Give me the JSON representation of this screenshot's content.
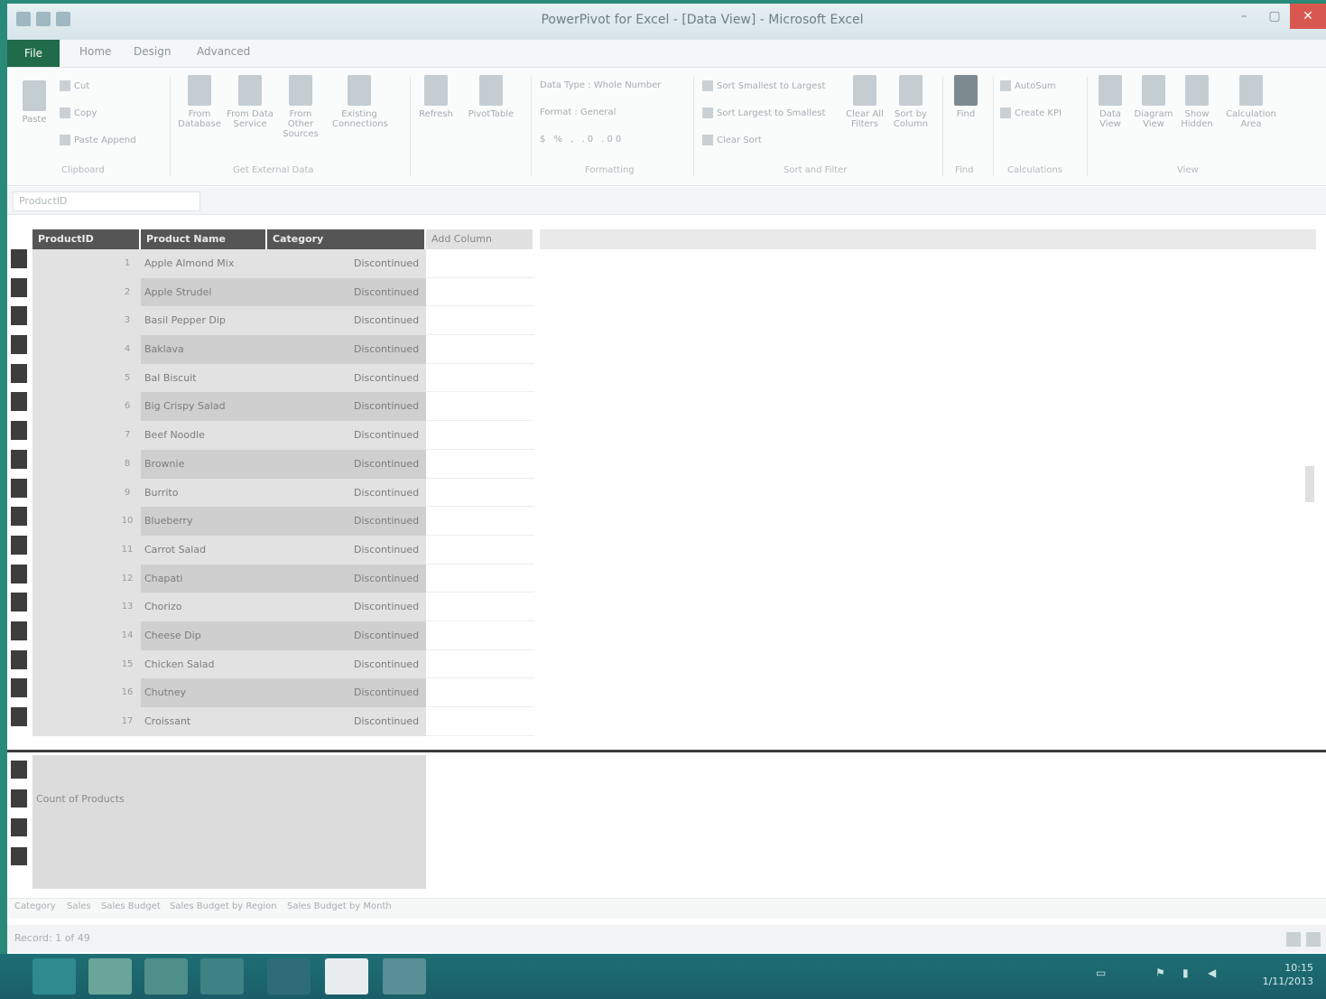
{
  "window": {
    "title": "PowerPivot for Excel - [Data View] - Microsoft Excel",
    "minimize_glyph": "–",
    "maximize_glyph": "▢",
    "close_glyph": "✕"
  },
  "tabs": [
    "File",
    "Home",
    "Design",
    "Advanced"
  ],
  "ribbon": {
    "clipboard": {
      "paste": "Paste",
      "items": [
        "Cut",
        "Copy",
        "Paste Append"
      ],
      "group": "Clipboard"
    },
    "get_data": {
      "buttons": [
        "From Database",
        "From Data Service",
        "From Other Sources",
        "Existing Connections"
      ],
      "group": "Get External Data"
    },
    "refresh": "Refresh",
    "pivottable": "PivotTable",
    "formatting": {
      "items": [
        "Data Type : Whole Number",
        "Format : General",
        "$ % , .0 .00"
      ],
      "group": "Formatting"
    },
    "sort_filter": {
      "items": [
        "Sort Smallest to Largest",
        "Sort Largest to Smallest",
        "Clear Sort"
      ],
      "buttons": [
        "Clear All Filters",
        "Sort by Column"
      ],
      "group": "Sort and Filter"
    },
    "find": {
      "button": "Find",
      "group": "Find"
    },
    "calculations": {
      "items": [
        "AutoSum",
        "Create KPI"
      ],
      "group": "Calculations"
    },
    "view": {
      "buttons": [
        "Data View",
        "Diagram View",
        "Show Hidden",
        "Calculation Area"
      ],
      "group": "View"
    }
  },
  "formula_bar": {
    "name_box": "ProductID",
    "value": ""
  },
  "columns": [
    "ProductID",
    "Product Name",
    "Category",
    "Add Column"
  ],
  "rows": [
    {
      "num": "1",
      "name": "Apple Almond Mix",
      "value": "Discontinued"
    },
    {
      "num": "2",
      "name": "Apple Strudel",
      "value": "Discontinued"
    },
    {
      "num": "3",
      "name": "Basil Pepper Dip",
      "value": "Discontinued"
    },
    {
      "num": "4",
      "name": "Baklava",
      "value": "Discontinued"
    },
    {
      "num": "5",
      "name": "Bal Biscuit",
      "value": "Discontinued"
    },
    {
      "num": "6",
      "name": "Big Crispy Salad",
      "value": "Discontinued"
    },
    {
      "num": "7",
      "name": "Beef Noodle",
      "value": "Discontinued"
    },
    {
      "num": "8",
      "name": "Brownie",
      "value": "Discontinued"
    },
    {
      "num": "9",
      "name": "Burrito",
      "value": "Discontinued"
    },
    {
      "num": "10",
      "name": "Blueberry",
      "value": "Discontinued"
    },
    {
      "num": "11",
      "name": "Carrot Salad",
      "value": "Discontinued"
    },
    {
      "num": "12",
      "name": "Chapati",
      "value": "Discontinued"
    },
    {
      "num": "13",
      "name": "Chorizo",
      "value": "Discontinued"
    },
    {
      "num": "14",
      "name": "Cheese Dip",
      "value": "Discontinued"
    },
    {
      "num": "15",
      "name": "Chicken Salad",
      "value": "Discontinued"
    },
    {
      "num": "16",
      "name": "Chutney",
      "value": "Discontinued"
    },
    {
      "num": "17",
      "name": "Croissant",
      "value": "Discontinued"
    }
  ],
  "calc_area": {
    "label": "Count of Products"
  },
  "sheet_tabs": [
    "Category",
    "Sales",
    "Sales Budget",
    "Sales Budget by Region",
    "Sales Budget by Month"
  ],
  "status": {
    "record": "Record: 1 of 49"
  },
  "taskbar": {
    "apps": [
      "internet-explorer",
      "file-explorer",
      "excel",
      "windows-store",
      "powerpoint",
      "word",
      "paint"
    ],
    "time": "10:15",
    "date": "1/11/2013"
  },
  "colors": {
    "file_tab": "#1f6b4a",
    "taskbar": "#1f6f75",
    "header": "#555555",
    "close": "#d8584f"
  }
}
